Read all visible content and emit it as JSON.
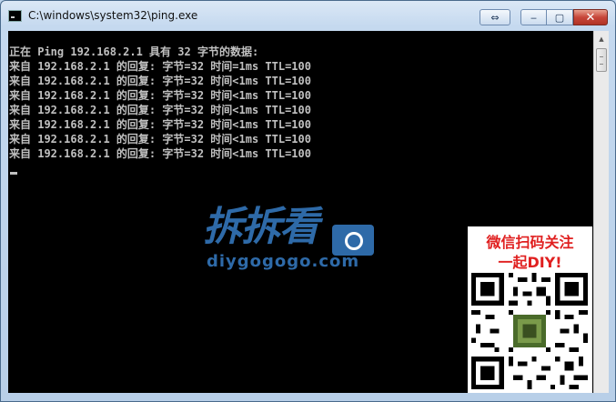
{
  "window": {
    "title": "C:\\windows\\system32\\ping.exe",
    "buttons": {
      "restore_down": "⇔",
      "minimize": "‒",
      "maximize": "▢",
      "close": "✕"
    }
  },
  "console": {
    "lines": [
      "正在 Ping 192.168.2.1 具有 32 字节的数据:",
      "来自 192.168.2.1 的回复: 字节=32 时间=1ms TTL=100",
      "来自 192.168.2.1 的回复: 字节=32 时间<1ms TTL=100",
      "来自 192.168.2.1 的回复: 字节=32 时间<1ms TTL=100",
      "来自 192.168.2.1 的回复: 字节=32 时间<1ms TTL=100",
      "来自 192.168.2.1 的回复: 字节=32 时间<1ms TTL=100",
      "来自 192.168.2.1 的回复: 字节=32 时间<1ms TTL=100",
      "来自 192.168.2.1 的回复: 字节=32 时间<1ms TTL=100"
    ]
  },
  "watermark": {
    "brand_cn": "拆拆看",
    "site": "diygogogo.com"
  },
  "qr_panel": {
    "line1": "微信扫码关注",
    "line2": "一起DIY!"
  },
  "colors": {
    "console_bg": "#000000",
    "console_text": "#c0c0c0",
    "brand_blue": "#2e6aa8",
    "promo_red": "#e02020"
  }
}
